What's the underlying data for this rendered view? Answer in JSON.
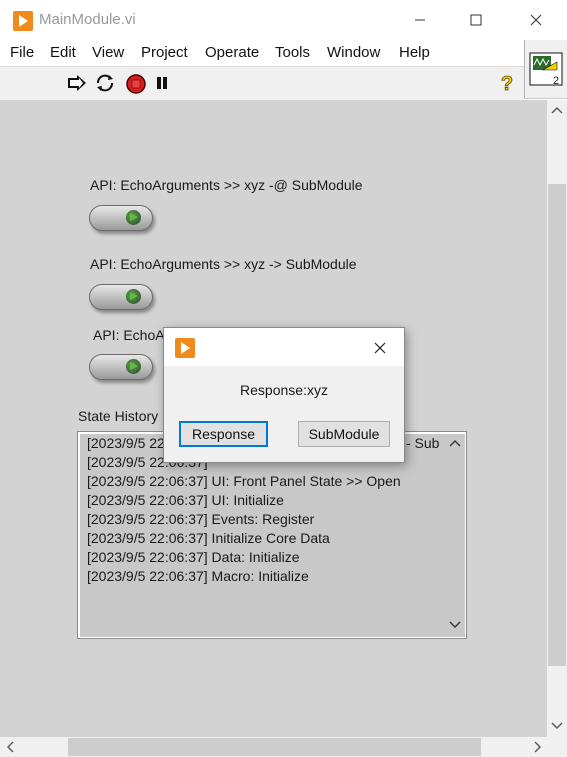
{
  "window": {
    "title": "MainModule.vi",
    "minimize_icon": "minimize-icon",
    "maximize_icon": "maximize-icon",
    "close_icon": "close-icon"
  },
  "menu": [
    "File",
    "Edit",
    "View",
    "Project",
    "Operate",
    "Tools",
    "Window",
    "Help"
  ],
  "toolbar": {
    "icons": [
      "run-arrow-icon",
      "run-continuously-icon",
      "abort-icon",
      "pause-icon",
      "context-help-icon"
    ],
    "vi_icon_number": "2"
  },
  "panel": {
    "api_buttons": [
      {
        "label": "API: EchoArguments >> xyz -@ SubModule"
      },
      {
        "label": "API: EchoArguments >> xyz -> SubModule"
      },
      {
        "label": "API: EchoA"
      }
    ],
    "state_history_label": "State History",
    "state_history_lines": [
      "[2023/9/5 22",
      "[2023/9/5 22:06:37]",
      "[2023/9/5 22:06:37] UI: Front Panel State >> Open",
      "[2023/9/5 22:06:37] UI: Initialize",
      "[2023/9/5 22:06:37] Events: Register",
      "[2023/9/5 22:06:37] Initialize Core Data",
      "[2023/9/5 22:06:37] Data: Initialize",
      "[2023/9/5 22:06:37] Macro: Initialize"
    ],
    "first_line_suffix": "- Sub"
  },
  "dialog": {
    "message": "Response:xyz",
    "buttons": [
      "Response",
      "SubModule"
    ]
  },
  "colors": {
    "panel_bg": "#d3d3d3",
    "labview_orange": "#f08a1c",
    "abort_red": "#d42020",
    "led_green": "#2f7a2f"
  }
}
